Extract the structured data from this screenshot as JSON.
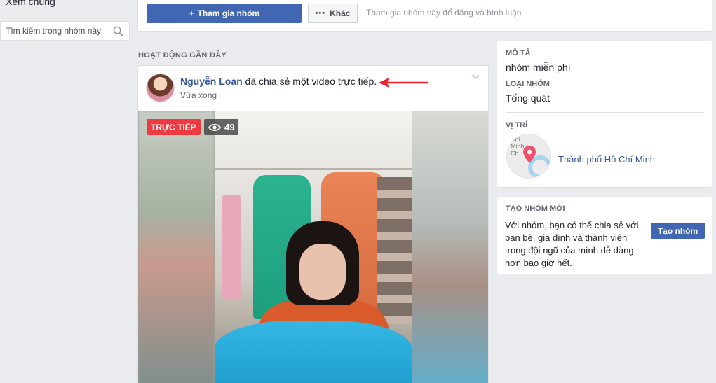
{
  "left": {
    "see_all": "Xem chung",
    "search_placeholder": "Tìm kiếm trong nhóm này"
  },
  "top_actions": {
    "join_label": "Tham gia nhóm",
    "more_label": "Khác",
    "hint": "Tham gia nhóm này để đăng và bình luận."
  },
  "activity": {
    "section_title": "HOẠT ĐỘNG GẦN ĐÂY",
    "post": {
      "author": "Nguyễn Loan",
      "action": " đã chia sẻ một video trực tiếp.",
      "time": "Vừa xong",
      "live_label": "TRỰC TIẾP",
      "viewer_count": "49"
    }
  },
  "about": {
    "description_label": "MÔ TẢ",
    "description_value": "nhóm miễn phí",
    "type_label": "LOẠI NHÓM",
    "type_value": "Tổng quát",
    "location_label": "VỊ TRÍ",
    "location_value": "Thành phố Hồ Chí Minh",
    "map_text": "Chí\nMinh\nCh"
  },
  "create_group": {
    "title": "TẠO NHÓM MỚI",
    "text": "Với nhóm, bạn có thể chia sẻ với bạn bè, gia đình và thành viên trong đội ngũ của mình dễ dàng hơn bao giờ hết.",
    "button_label": "Tạo nhóm"
  },
  "colors": {
    "brand_blue": "#4267b2",
    "link_blue": "#365899",
    "live_red": "#ed3b41",
    "annotation_arrow": "#e8212a"
  }
}
